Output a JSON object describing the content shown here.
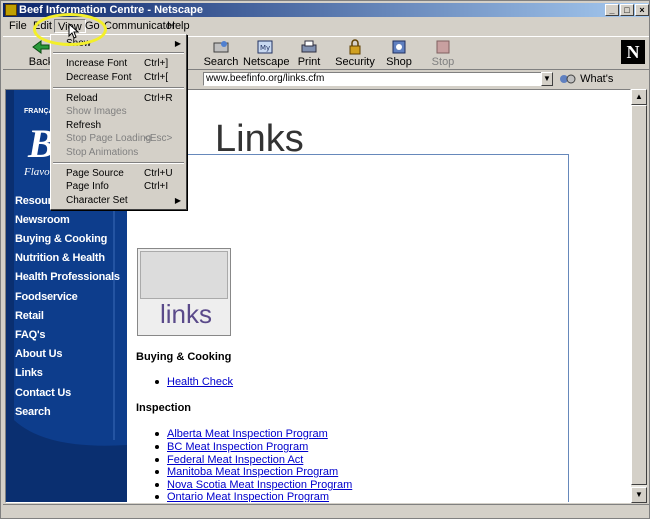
{
  "window": {
    "title": "Beef Information Centre - Netscape",
    "buttons": [
      "_",
      "□",
      "×"
    ]
  },
  "menubar": {
    "items": [
      "File",
      "Edit",
      "View",
      "Go",
      "Communicator",
      "Help"
    ]
  },
  "toolbar": {
    "buttons": [
      {
        "label": "Back",
        "icon": "back-arrow-icon"
      },
      {
        "label": "Search",
        "icon": "search-icon"
      },
      {
        "label": "Netscape",
        "icon": "netscape-home-icon"
      },
      {
        "label": "Print",
        "icon": "print-icon"
      },
      {
        "label": "Security",
        "icon": "security-lock-icon"
      },
      {
        "label": "Shop",
        "icon": "shop-icon"
      },
      {
        "label": "Stop",
        "icon": "stop-icon",
        "disabled": true
      }
    ],
    "logo": "N"
  },
  "location": {
    "url": "www.beefinfo.org/links.cfm",
    "related_label": "What's Related"
  },
  "view_menu": {
    "items": [
      {
        "label": "Show",
        "has_submenu": true
      },
      {
        "separator": true
      },
      {
        "label": "Increase Font",
        "shortcut": "Ctrl+]"
      },
      {
        "label": "Decrease Font",
        "shortcut": "Ctrl+["
      },
      {
        "separator": true
      },
      {
        "label": "Reload",
        "shortcut": "Ctrl+R"
      },
      {
        "label": "Show Images",
        "disabled": true
      },
      {
        "label": "Refresh"
      },
      {
        "label": "Stop Page Loading",
        "shortcut": "<Esc>",
        "disabled": true
      },
      {
        "label": "Stop Animations",
        "disabled": true
      },
      {
        "separator": true
      },
      {
        "label": "Page Source",
        "shortcut": "Ctrl+U"
      },
      {
        "label": "Page Info",
        "shortcut": "Ctrl+I"
      },
      {
        "label": "Character Set",
        "has_submenu": true
      }
    ]
  },
  "sidebar": {
    "francais": "FRANÇAIS",
    "logo_text": "Be",
    "tagline": "Flavour",
    "nav": [
      "Resources",
      "Newsroom",
      "Buying & Cooking",
      "Nutrition & Health",
      "Health Professionals",
      "Foodservice",
      "Retail",
      "FAQ's",
      "About Us",
      "Links",
      "Contact Us",
      "Search"
    ]
  },
  "page": {
    "title": "Links",
    "image_word": "links",
    "sections": [
      {
        "heading": "Buying & Cooking",
        "links": [
          "Health Check"
        ]
      },
      {
        "heading": "Inspection",
        "links": [
          "Alberta Meat Inspection Program",
          "BC Meat Inspection Program",
          "Federal Meat Inspection Act",
          "Manitoba Meat Inspection Program",
          "Nova Scotia Meat Inspection Program",
          "Ontario Meat Inspection Program"
        ]
      }
    ]
  },
  "colors": {
    "sidebar": "#0d3d8c",
    "link": "#0000cc",
    "highlight_circle": "#f3ef2a",
    "title_bar": "#0a246a"
  }
}
